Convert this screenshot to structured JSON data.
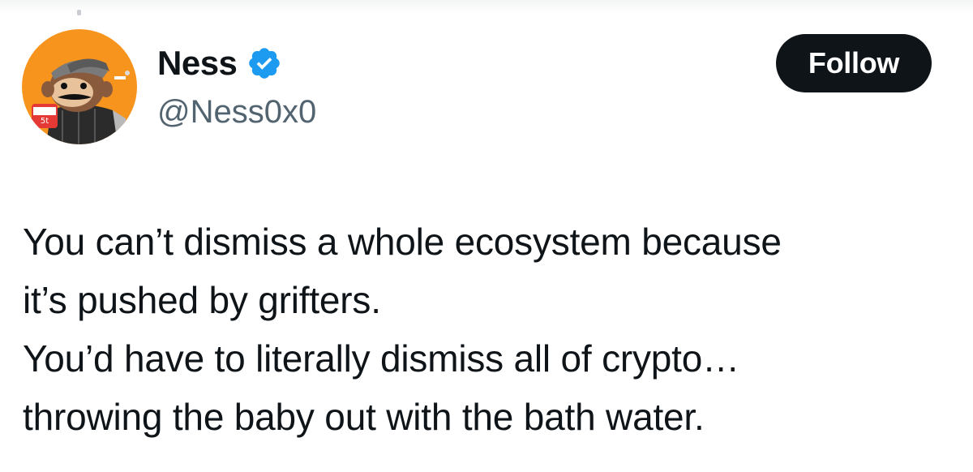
{
  "tweet": {
    "author": {
      "display_name": "Ness",
      "handle": "@Ness0x0",
      "verified": true,
      "verified_color": "#1d9bf0"
    },
    "follow_label": "Follow",
    "text_lines": [
      "You can’t dismiss a whole ecosystem because",
      "it’s pushed by grifters.",
      "You’d have to literally dismiss all of crypto…",
      "throwing the baby out with the bath water."
    ]
  },
  "colors": {
    "text_primary": "#0f1419",
    "text_secondary": "#536471",
    "follow_bg": "#0f1419",
    "avatar_bg": "#f7941d"
  }
}
